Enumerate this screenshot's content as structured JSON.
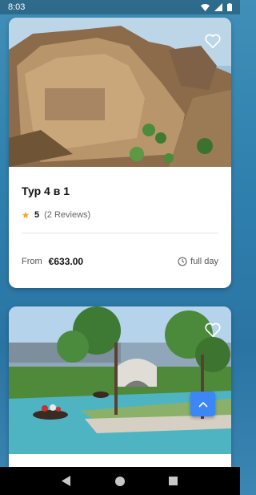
{
  "status_bar": {
    "time": "8:03"
  },
  "tours": [
    {
      "title": "Тур 4 в 1",
      "rating": "5",
      "reviews": "(2 Reviews)",
      "from_label": "From",
      "price": "€633.00",
      "duration": "full day",
      "image_icon": "rock-carving-photo"
    },
    {
      "image_icon": "canal-park-photo"
    }
  ],
  "icons": {
    "favorite": "heart-icon",
    "star": "star-icon",
    "clock": "clock-icon",
    "scroll_top": "chevron-up-icon"
  },
  "colors": {
    "accent": "#3d86f5",
    "star": "#f5a623",
    "card_bg": "#ffffff",
    "nav_bg": "#000000"
  }
}
